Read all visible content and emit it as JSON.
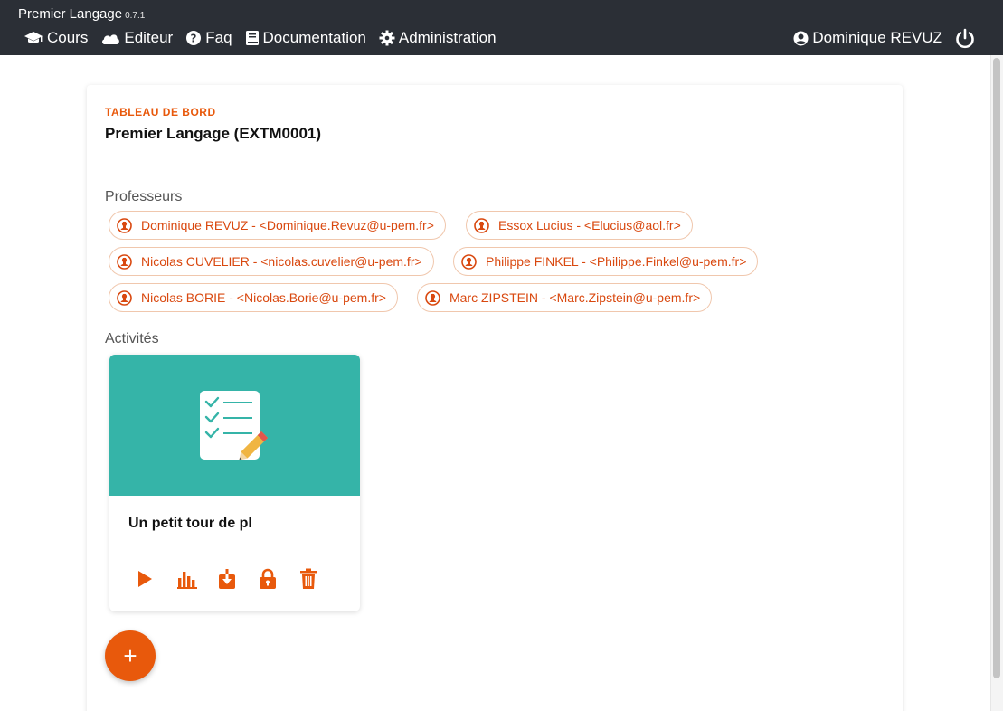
{
  "app": {
    "name": "Premier Langage",
    "version": "0.7.1"
  },
  "nav": {
    "items": [
      {
        "label": "Cours",
        "icon": "graduation-cap-icon"
      },
      {
        "label": "Editeur",
        "icon": "cloud-icon"
      },
      {
        "label": "Faq",
        "icon": "question-circle-icon"
      },
      {
        "label": "Documentation",
        "icon": "book-icon"
      },
      {
        "label": "Administration",
        "icon": "gear-icon"
      }
    ],
    "user": "Dominique REVUZ"
  },
  "dashboard": {
    "eyebrow": "TABLEAU DE BORD",
    "title": "Premier Langage (EXTM0001)",
    "professors_label": "Professeurs",
    "professors": [
      "Dominique REVUZ - <Dominique.Revuz@u-pem.fr>",
      "Essox Lucius - <Elucius@aol.fr>",
      "Nicolas CUVELIER - <nicolas.cuvelier@u-pem.fr>",
      "Philippe FINKEL - <Philippe.Finkel@u-pem.fr>",
      "Nicolas BORIE - <Nicolas.Borie@u-pem.fr>",
      "Marc ZIPSTEIN - <Marc.Zipstein@u-pem.fr>"
    ],
    "activities_label": "Activités",
    "activities": [
      {
        "title": "Un petit tour de pl"
      }
    ],
    "add_label": "+"
  },
  "colors": {
    "accent": "#e8590c",
    "navbar": "#2b2f36",
    "card_media": "#35b4a8"
  }
}
